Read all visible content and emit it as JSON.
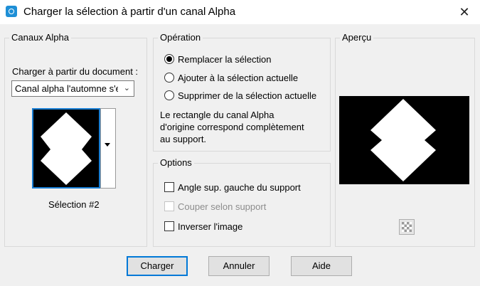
{
  "window": {
    "title": "Charger la sélection à partir d'un canal Alpha",
    "app_icon": "psp-app-icon",
    "close_glyph": "✕"
  },
  "channels": {
    "legend": "Canaux Alpha",
    "load_label": "Charger à partir du document :",
    "document_value": "Canal alpha l'automne s'e",
    "selection_label": "Sélection #2"
  },
  "operation": {
    "legend": "Opération",
    "options": [
      {
        "label": "Remplacer la sélection",
        "selected": true
      },
      {
        "label": "Ajouter à la sélection actuelle",
        "selected": false
      },
      {
        "label": "Supprimer de la sélection actuelle",
        "selected": false
      }
    ],
    "note_lines": [
      "Le rectangle du canal Alpha",
      "d'origine correspond complètement",
      "au support."
    ]
  },
  "options": {
    "legend": "Options",
    "checkboxes": [
      {
        "label": "Angle sup. gauche du support",
        "checked": false,
        "enabled": true
      },
      {
        "label": "Couper selon support",
        "checked": false,
        "enabled": false
      },
      {
        "label": "Inverser l'image",
        "checked": false,
        "enabled": true
      }
    ]
  },
  "preview": {
    "legend": "Aperçu",
    "toggle_icon": "checkerboard-icon"
  },
  "buttons": {
    "ok": "Charger",
    "cancel": "Annuler",
    "help": "Aide"
  },
  "colors": {
    "focus_blue": "#0078d7",
    "background": "#f0f0f0"
  }
}
